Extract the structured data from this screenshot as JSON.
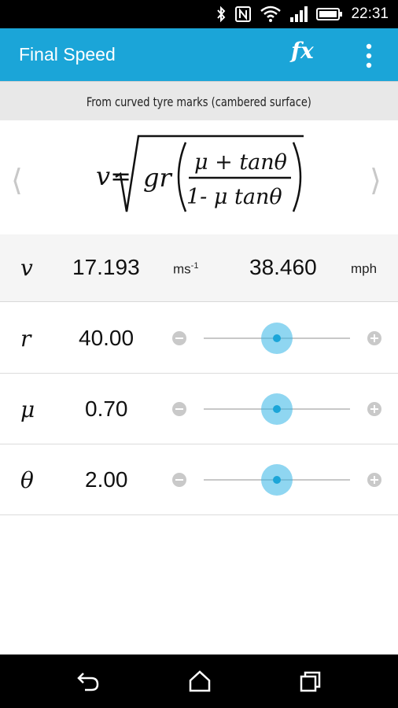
{
  "status_bar": {
    "time": "22:31",
    "icons": [
      "bluetooth-icon",
      "nfc-icon",
      "wifi-icon",
      "signal-icon",
      "battery-icon"
    ]
  },
  "app_bar": {
    "title": "Final Speed",
    "fx_label": "fx",
    "menu_icon": "overflow-menu-icon"
  },
  "subtitle": "From curved tyre marks (cambered surface)",
  "formula": {
    "lhs": "v=",
    "radicand_prefix": "gr",
    "numerator": "μ + tanθ",
    "denominator": "1- μ tanθ",
    "prev_icon": "chevron-left-icon",
    "next_icon": "chevron-right-icon"
  },
  "result": {
    "symbol": "v",
    "value_si": "17.193",
    "unit_si_base": "ms",
    "unit_si_exp": "-1",
    "value_imperial": "38.460",
    "unit_imperial": "mph"
  },
  "variables": [
    {
      "symbol": "r",
      "value": "40.00",
      "slider_fraction": 0.5
    },
    {
      "symbol": "μ",
      "value": "0.70",
      "slider_fraction": 0.5
    },
    {
      "symbol": "θ",
      "value": "2.00",
      "slider_fraction": 0.5
    }
  ],
  "nav_bar": {
    "icons": [
      "back-icon",
      "home-icon",
      "recents-icon"
    ]
  },
  "colors": {
    "accent": "#1ba5d8",
    "slider_thumb": "#33b5e5"
  }
}
